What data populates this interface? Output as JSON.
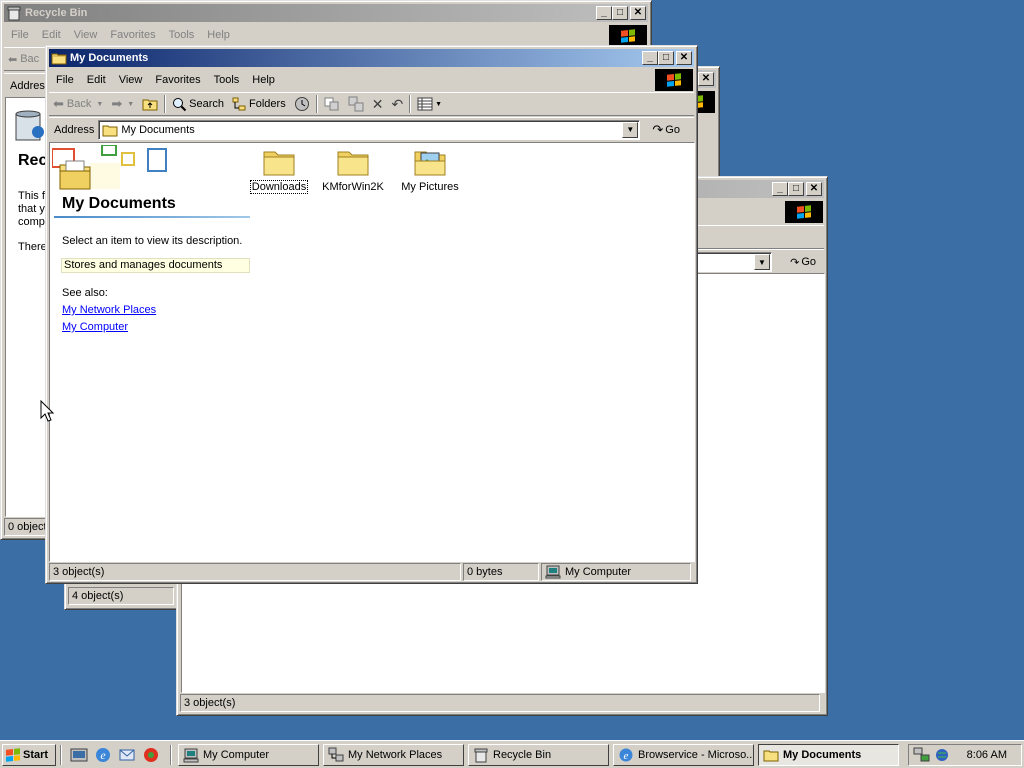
{
  "recycle": {
    "title": "Recycle Bin",
    "menu": [
      "File",
      "Edit",
      "View",
      "Favorites",
      "Tools",
      "Help"
    ],
    "back_label": "Bac",
    "address_label": "Addres",
    "heading": "Rec",
    "desc": [
      "This f",
      "that y",
      "comp"
    ],
    "desc2": "There",
    "status": "0 object"
  },
  "browser": {
    "go_label": "Go",
    "status": "3 object(s)"
  },
  "network": {
    "status": "4 object(s)"
  },
  "mydocs": {
    "title": "My Documents",
    "menu": [
      "File",
      "Edit",
      "View",
      "Favorites",
      "Tools",
      "Help"
    ],
    "toolbar": {
      "back": "Back",
      "search": "Search",
      "folders": "Folders"
    },
    "address_label": "Address",
    "address_value": "My Documents",
    "go_label": "Go",
    "panel": {
      "heading": "My Documents",
      "select_text": "Select an item to view its description.",
      "description": "Stores and manages documents",
      "see_also": "See also:",
      "links": [
        "My Network Places",
        "My Computer"
      ]
    },
    "items": [
      {
        "label": "Downloads",
        "icon": "folder-icon"
      },
      {
        "label": "KMforWin2K",
        "icon": "folder-icon"
      },
      {
        "label": "My Pictures",
        "icon": "pictures-folder-icon"
      }
    ],
    "status": {
      "objects": "3 object(s)",
      "size": "0 bytes",
      "zone": "My Computer"
    }
  },
  "taskbar": {
    "start": "Start",
    "tasks": [
      {
        "label": "My Computer",
        "icon": "computer-icon",
        "active": false
      },
      {
        "label": "My Network Places",
        "icon": "network-icon",
        "active": false
      },
      {
        "label": "Recycle Bin",
        "icon": "recycle-bin-icon",
        "active": false
      },
      {
        "label": "Browservice - Microso...",
        "icon": "ie-icon",
        "active": false
      },
      {
        "label": "My Documents",
        "icon": "folder-icon",
        "active": true
      }
    ],
    "clock": "8:06 AM"
  },
  "colors": {
    "desktop": "#3a6ea5",
    "title_active": "#0a246a",
    "title_inactive": "#808080",
    "panel_highlight": "#ffffe1",
    "link": "#0000ff"
  }
}
